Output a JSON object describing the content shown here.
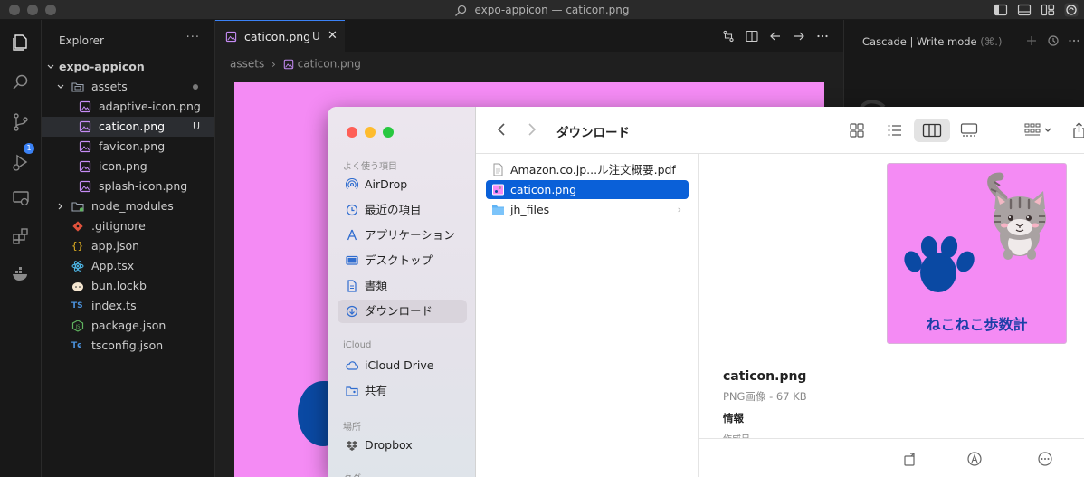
{
  "window": {
    "title": "expo-appicon — caticon.png"
  },
  "activity": {
    "scm_badge": "1"
  },
  "explorer": {
    "header": "Explorer",
    "more": "···",
    "root": "expo-appicon",
    "assets_folder": "assets",
    "assets_files": [
      {
        "name": "adaptive-icon.png",
        "status": ""
      },
      {
        "name": "caticon.png",
        "status": "U"
      },
      {
        "name": "favicon.png",
        "status": ""
      },
      {
        "name": "icon.png",
        "status": ""
      },
      {
        "name": "splash-icon.png",
        "status": ""
      }
    ],
    "node_modules": "node_modules",
    "root_files": [
      {
        "name": ".gitignore",
        "icon": "git-icon",
        "color": "#e0523c"
      },
      {
        "name": "app.json",
        "icon": "json-braces-icon",
        "color": "#e6b422"
      },
      {
        "name": "App.tsx",
        "icon": "react-icon",
        "color": "#4fb8e8"
      },
      {
        "name": "bun.lockb",
        "icon": "bun-icon",
        "color": "#f5e6d0"
      },
      {
        "name": "index.ts",
        "icon": "ts-icon",
        "color": "#4a90d9"
      },
      {
        "name": "package.json",
        "icon": "npm-json-icon",
        "color": "#5fb35f"
      },
      {
        "name": "tsconfig.json",
        "icon": "tsconfig-icon",
        "color": "#4a90d9"
      }
    ]
  },
  "editor": {
    "tab_label": "caticon.png",
    "tab_status": "U",
    "tab_close": "✕",
    "breadcrumb": [
      "assets",
      "caticon.png"
    ],
    "breadcrumb_sep": "›"
  },
  "cascade": {
    "title": "Cascade | Write mode",
    "shortcut": "(⌘.)"
  },
  "finder": {
    "title": "ダウンロード",
    "sidebar_sections": {
      "favorites": "よく使う項目",
      "icloud": "iCloud",
      "locations": "場所",
      "tags": "タグ"
    },
    "favorites": [
      {
        "label": "AirDrop",
        "icon": "airdrop-icon"
      },
      {
        "label": "最近の項目",
        "icon": "clock-icon"
      },
      {
        "label": "アプリケーション",
        "icon": "applications-icon"
      },
      {
        "label": "デスクトップ",
        "icon": "desktop-icon"
      },
      {
        "label": "書類",
        "icon": "document-icon"
      },
      {
        "label": "ダウンロード",
        "icon": "download-icon"
      }
    ],
    "icloud_items": [
      {
        "label": "iCloud Drive",
        "icon": "cloud-icon"
      },
      {
        "label": "共有",
        "icon": "shared-folder-icon"
      }
    ],
    "location_items": [
      {
        "label": "Dropbox",
        "icon": "dropbox-icon"
      }
    ],
    "files": [
      {
        "name": "Amazon.co.jp...ル注文概要.pdf",
        "icon": "pdf-file-icon"
      },
      {
        "name": "caticon.png",
        "icon": "png-file-icon"
      },
      {
        "name": "jh_files",
        "icon": "folder-icon",
        "arrow": "›"
      }
    ],
    "preview": {
      "thumb_text": "ねこねこ歩数計",
      "name": "caticon.png",
      "kind": "PNG画像 - 67 KB",
      "info_label": "情報",
      "created_label": "作成日"
    }
  },
  "colors": {
    "accent": "#3b82f6",
    "finder_selection": "#0a60d8",
    "preview_bg": "#f48bf4",
    "paw_blue": "#0a49a3"
  }
}
